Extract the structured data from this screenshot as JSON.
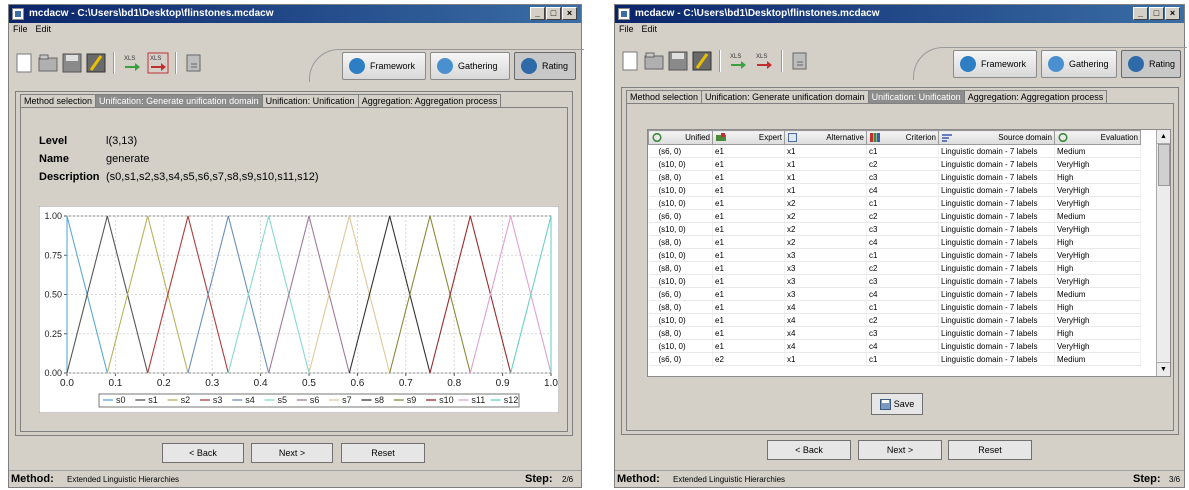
{
  "left_window": {
    "title": "mcdacw - C:\\Users\\bd1\\Desktop\\flinstones.mcdacw",
    "menu": [
      "File",
      "Edit"
    ],
    "mode_buttons": [
      {
        "label": "Framework",
        "icon": "framework-icon",
        "active": false
      },
      {
        "label": "Gathering",
        "icon": "check-icon",
        "active": false
      },
      {
        "label": "Rating",
        "icon": "rating-icon",
        "active": true
      }
    ],
    "tabs": [
      "Method selection",
      "Unification: Generate unification domain",
      "Unification: Unification",
      "Aggregation: Aggregation process"
    ],
    "active_tab": 1,
    "info": {
      "level_label": "Level",
      "level_value": "l(3,13)",
      "name_label": "Name",
      "name_value": "generate",
      "description_label": "Description",
      "description_value": "(s0,s1,s2,s3,s4,s5,s6,s7,s8,s9,s10,s11,s12)"
    },
    "buttons": {
      "back": "< Back",
      "next": "Next >",
      "reset": "Reset"
    },
    "status": {
      "method_label": "Method:",
      "method_value": "Extended Linguistic Hierarchies",
      "step_label": "Step:",
      "step_value": "2/6"
    }
  },
  "chart_data": {
    "type": "line",
    "title": "",
    "xlabel": "",
    "ylabel": "",
    "xlim": [
      0.0,
      1.0
    ],
    "ylim": [
      0.0,
      1.0
    ],
    "x_ticks": [
      "0.0",
      "0.1",
      "0.2",
      "0.3",
      "0.4",
      "0.5",
      "0.6",
      "0.7",
      "0.8",
      "0.9",
      "1.0"
    ],
    "y_ticks": [
      "0.00",
      "0.25",
      "0.50",
      "0.75",
      "1.00"
    ],
    "grid": true,
    "legend_position": "bottom",
    "series": [
      {
        "name": "s0",
        "color": "#5aa9d6",
        "x": [
          0,
          0,
          0.0833
        ],
        "y": [
          0,
          1,
          0
        ]
      },
      {
        "name": "s1",
        "color": "#555555",
        "x": [
          0,
          0.0833,
          0.1667
        ],
        "y": [
          0,
          1,
          0
        ]
      },
      {
        "name": "s2",
        "color": "#b9b15a",
        "x": [
          0.0833,
          0.1667,
          0.25
        ],
        "y": [
          0,
          1,
          0
        ]
      },
      {
        "name": "s3",
        "color": "#b03a3a",
        "x": [
          0.1667,
          0.25,
          0.3333
        ],
        "y": [
          0,
          1,
          0
        ]
      },
      {
        "name": "s4",
        "color": "#6a8fb8",
        "x": [
          0.25,
          0.3333,
          0.4167
        ],
        "y": [
          0,
          1,
          0
        ]
      },
      {
        "name": "s5",
        "color": "#88d8d0",
        "x": [
          0.3333,
          0.4167,
          0.5
        ],
        "y": [
          0,
          1,
          0
        ]
      },
      {
        "name": "s6",
        "color": "#a07a9a",
        "x": [
          0.4167,
          0.5,
          0.5833
        ],
        "y": [
          0,
          1,
          0
        ]
      },
      {
        "name": "s7",
        "color": "#e0c89a",
        "x": [
          0.5,
          0.5833,
          0.6667
        ],
        "y": [
          0,
          1,
          0
        ]
      },
      {
        "name": "s8",
        "color": "#333333",
        "x": [
          0.5833,
          0.6667,
          0.75
        ],
        "y": [
          0,
          1,
          0
        ]
      },
      {
        "name": "s9",
        "color": "#8a8a3a",
        "x": [
          0.6667,
          0.75,
          0.8333
        ],
        "y": [
          0,
          1,
          0
        ]
      },
      {
        "name": "s10",
        "color": "#9a2a2a",
        "x": [
          0.75,
          0.8333,
          0.9167
        ],
        "y": [
          0,
          1,
          0
        ]
      },
      {
        "name": "s11",
        "color": "#e0a0d0",
        "x": [
          0.8333,
          0.9167,
          1.0
        ],
        "y": [
          0,
          1,
          0
        ]
      },
      {
        "name": "s12",
        "color": "#6ad0c8",
        "x": [
          0.9167,
          1.0,
          1.0
        ],
        "y": [
          0,
          1,
          0
        ]
      }
    ]
  },
  "right_window": {
    "title": "mcdacw - C:\\Users\\bd1\\Desktop\\flinstones.mcdacw",
    "menu": [
      "File",
      "Edit"
    ],
    "mode_buttons": [
      {
        "label": "Framework",
        "icon": "framework-icon",
        "active": false
      },
      {
        "label": "Gathering",
        "icon": "check-icon",
        "active": false
      },
      {
        "label": "Rating",
        "icon": "rating-icon",
        "active": true
      }
    ],
    "tabs": [
      "Method selection",
      "Unification: Generate unification domain",
      "Unification: Unification",
      "Aggregation: Aggregation process"
    ],
    "active_tab": 2,
    "table": {
      "columns": [
        "Unified",
        "Expert",
        "Alternative",
        "Criterion",
        "Source domain",
        "Evaluation"
      ],
      "rows": [
        [
          "(s6, 0)",
          "e1",
          "x1",
          "c1",
          "Linguistic domain - 7 labels",
          "Medium"
        ],
        [
          "(s10, 0)",
          "e1",
          "x1",
          "c2",
          "Linguistic domain - 7 labels",
          "VeryHigh"
        ],
        [
          "(s8, 0)",
          "e1",
          "x1",
          "c3",
          "Linguistic domain - 7 labels",
          "High"
        ],
        [
          "(s10, 0)",
          "e1",
          "x1",
          "c4",
          "Linguistic domain - 7 labels",
          "VeryHigh"
        ],
        [
          "(s10, 0)",
          "e1",
          "x2",
          "c1",
          "Linguistic domain - 7 labels",
          "VeryHigh"
        ],
        [
          "(s6, 0)",
          "e1",
          "x2",
          "c2",
          "Linguistic domain - 7 labels",
          "Medium"
        ],
        [
          "(s10, 0)",
          "e1",
          "x2",
          "c3",
          "Linguistic domain - 7 labels",
          "VeryHigh"
        ],
        [
          "(s8, 0)",
          "e1",
          "x2",
          "c4",
          "Linguistic domain - 7 labels",
          "High"
        ],
        [
          "(s10, 0)",
          "e1",
          "x3",
          "c1",
          "Linguistic domain - 7 labels",
          "VeryHigh"
        ],
        [
          "(s8, 0)",
          "e1",
          "x3",
          "c2",
          "Linguistic domain - 7 labels",
          "High"
        ],
        [
          "(s10, 0)",
          "e1",
          "x3",
          "c3",
          "Linguistic domain - 7 labels",
          "VeryHigh"
        ],
        [
          "(s6, 0)",
          "e1",
          "x3",
          "c4",
          "Linguistic domain - 7 labels",
          "Medium"
        ],
        [
          "(s8, 0)",
          "e1",
          "x4",
          "c1",
          "Linguistic domain - 7 labels",
          "High"
        ],
        [
          "(s10, 0)",
          "e1",
          "x4",
          "c2",
          "Linguistic domain - 7 labels",
          "VeryHigh"
        ],
        [
          "(s8, 0)",
          "e1",
          "x4",
          "c3",
          "Linguistic domain - 7 labels",
          "High"
        ],
        [
          "(s10, 0)",
          "e1",
          "x4",
          "c4",
          "Linguistic domain - 7 labels",
          "VeryHigh"
        ],
        [
          "(s6, 0)",
          "e2",
          "x1",
          "c1",
          "Linguistic domain - 7 labels",
          "Medium"
        ]
      ]
    },
    "save_label": "Save",
    "buttons": {
      "back": "< Back",
      "next": "Next >",
      "reset": "Reset"
    },
    "status": {
      "method_label": "Method:",
      "method_value": "Extended Linguistic Hierarchies",
      "step_label": "Step:",
      "step_value": "3/6"
    }
  }
}
